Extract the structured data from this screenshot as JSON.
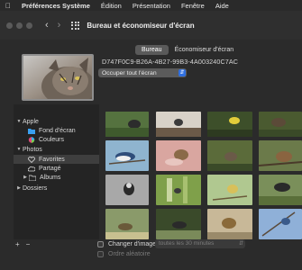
{
  "menubar": {
    "items": [
      "Préférences Système",
      "Édition",
      "Présentation",
      "Fenêtre",
      "Aide"
    ]
  },
  "window": {
    "title": "Bureau et économiseur d'écran"
  },
  "tabs": [
    "Bureau",
    "Économiseur d'écran"
  ],
  "current": {
    "image_id": "D747F0C9-B26A-4B27-99B3-4A003240C7AC",
    "fit_option": "Occuper tout l'écran"
  },
  "sidebar": {
    "apple_header": "Apple",
    "apple_items": [
      "Fond d'écran",
      "Couleurs"
    ],
    "photos_header": "Photos",
    "photos_items": [
      "Favorites",
      "Partagé",
      "Albums"
    ],
    "folders_header": "Dossiers"
  },
  "bottom": {
    "add": "+",
    "remove": "−",
    "change_image_label": "Changer d'image :",
    "interval_value": "toutes les 30 minutes",
    "random_label": "Ordre aléatoire"
  }
}
